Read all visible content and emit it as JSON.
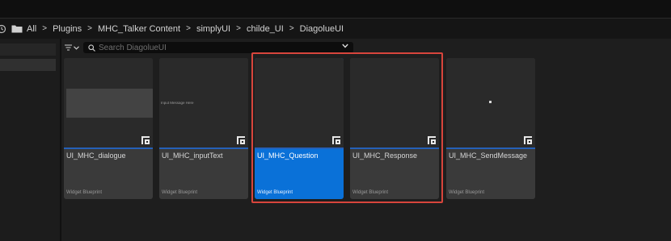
{
  "breadcrumb": {
    "items": [
      "All",
      "Plugins",
      "MHC_Talker Content",
      "simplyUI",
      "childe_UI",
      "DiagolueUI"
    ],
    "separator": ">"
  },
  "search": {
    "placeholder": "Search DiagolueUI"
  },
  "colors": {
    "selection_outline": "#d8453c",
    "selected_tile": "#0a71d8",
    "asset_underline": "#2560b8"
  },
  "assets": [
    {
      "name": "UI_MHC_dialogue",
      "type": "Widget Blueprint",
      "thumb_text": ""
    },
    {
      "name": "UI_MHC_inputText",
      "type": "Widget Blueprint",
      "thumb_text": "Input Message Here"
    },
    {
      "name": "UI_MHC_Question",
      "type": "Widget Blueprint",
      "thumb_text": "",
      "selected": true
    },
    {
      "name": "UI_MHC_Response",
      "type": "Widget Blueprint",
      "thumb_text": ""
    },
    {
      "name": "UI_MHC_SendMessage",
      "type": "Widget Blueprint",
      "thumb_text": ""
    }
  ]
}
